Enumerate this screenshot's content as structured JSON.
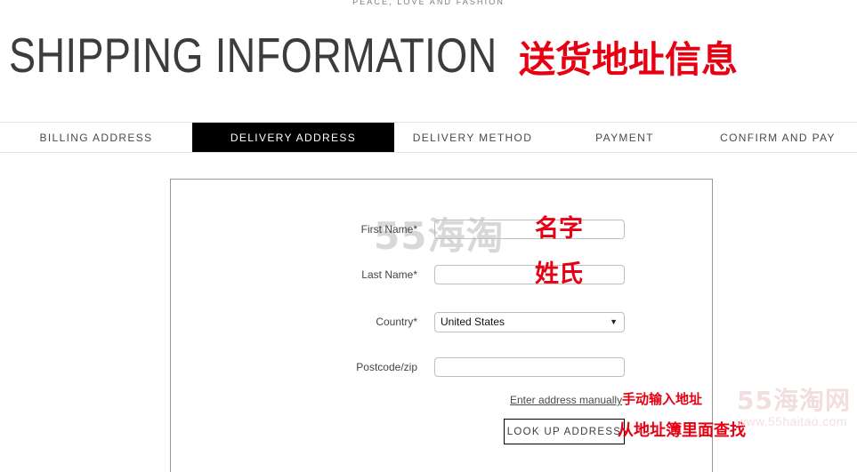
{
  "brand": {
    "tagline": "PEACE, LOVE AND FASHION"
  },
  "header": {
    "title": "SHIPPING INFORMATION",
    "title_annotation_cn": "送货地址信息",
    "accent_color": "#e60012"
  },
  "checkout_steps": {
    "active_index": 1,
    "tabs": [
      {
        "label": "BILLING ADDRESS"
      },
      {
        "label": "DELIVERY ADDRESS"
      },
      {
        "label": "DELIVERY METHOD"
      },
      {
        "label": "PAYMENT"
      },
      {
        "label": "CONFIRM AND PAY"
      }
    ]
  },
  "form": {
    "fields": [
      {
        "label": "First Name*",
        "value": "",
        "placeholder": "",
        "annotation_cn": "名字",
        "type": "text"
      },
      {
        "label": "Last Name*",
        "value": "",
        "placeholder": "",
        "annotation_cn": "姓氏",
        "type": "text"
      },
      {
        "label": "Country*",
        "value": "United States",
        "placeholder": "",
        "annotation_cn": "",
        "type": "select",
        "caret": "▼"
      },
      {
        "label": "Postcode/zip",
        "value": "",
        "placeholder": "",
        "annotation_cn": "",
        "type": "text"
      }
    ],
    "manual_link": {
      "label": "Enter address manually",
      "annotation_cn": "手动输入地址"
    },
    "lookup_button": {
      "label": "LOOK UP ADDRESS",
      "annotation_cn": "从地址簿里面查找"
    }
  },
  "watermarks": {
    "center": "55海淘",
    "corner_main": "55海淘网",
    "corner_sub": "www.55haitao.com"
  }
}
